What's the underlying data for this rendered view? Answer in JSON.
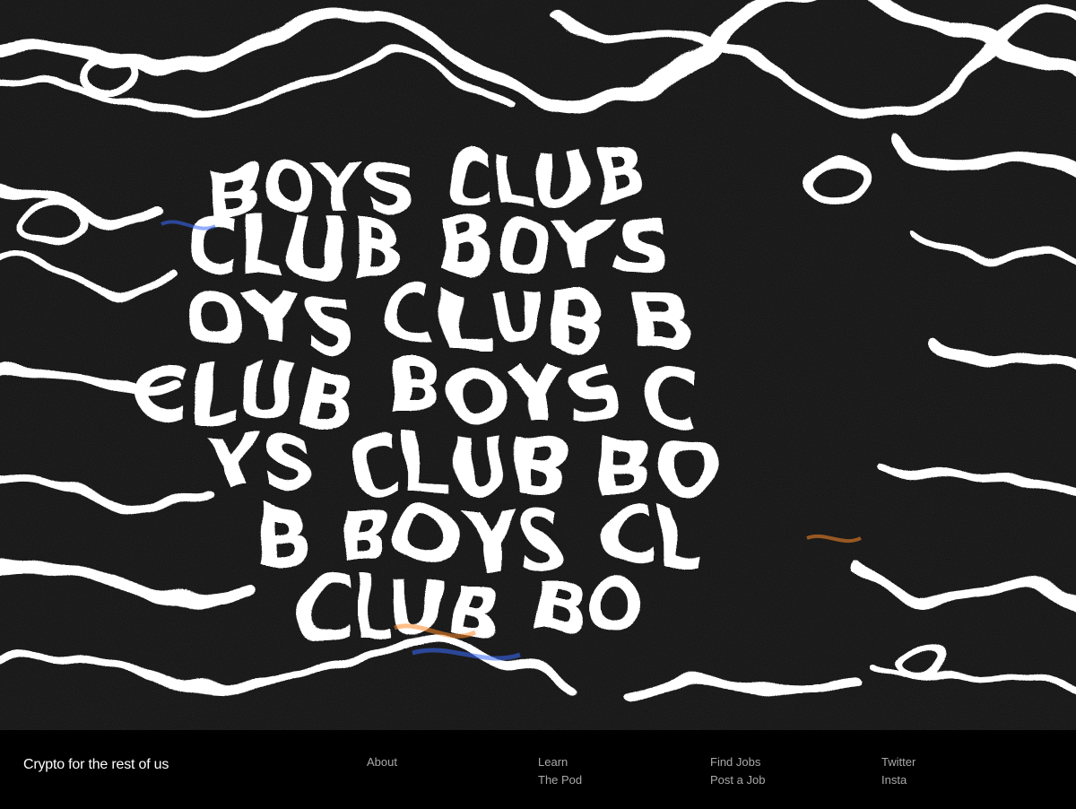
{
  "hero": {
    "lines": [
      "BOYS CLUB",
      "CLUB BOYS",
      "OYS CLUB B",
      "CLUB BOYS C",
      "YS CLUB BO",
      "B BOYS CL",
      "CLUB BO"
    ],
    "colors": {
      "background": "#111111",
      "swirl": "#ffffff",
      "accent_orange": "#ff8a2a",
      "accent_blue": "#3a6cff"
    }
  },
  "footer": {
    "tagline": "Crypto for the rest of us",
    "columns": [
      {
        "links": [
          "About"
        ]
      },
      {
        "links": [
          "Learn",
          "The Pod"
        ]
      },
      {
        "links": [
          "Find Jobs",
          "Post a Job"
        ]
      },
      {
        "links": [
          "Twitter",
          "Insta"
        ]
      }
    ],
    "colors": {
      "background": "#000000",
      "tagline": "#ffffff",
      "link": "#a9a9a9"
    }
  }
}
